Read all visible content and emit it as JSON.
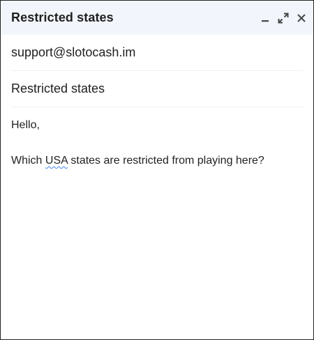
{
  "window": {
    "title": "Restricted states"
  },
  "controls": {
    "minimize_icon": "minimize-icon",
    "fullscreen_icon": "expand-icon",
    "close_icon": "close-icon"
  },
  "recipient": {
    "value": "support@slotocash.im"
  },
  "subject": {
    "value": "Restricted states"
  },
  "message": {
    "greeting": "Hello,",
    "line_before": "Which ",
    "misspelled_word": "USA",
    "line_after": " states are restricted from playing here?"
  },
  "colors": {
    "header_bg": "#f2f6fc",
    "spellcheck_underline": "#4285f4"
  }
}
